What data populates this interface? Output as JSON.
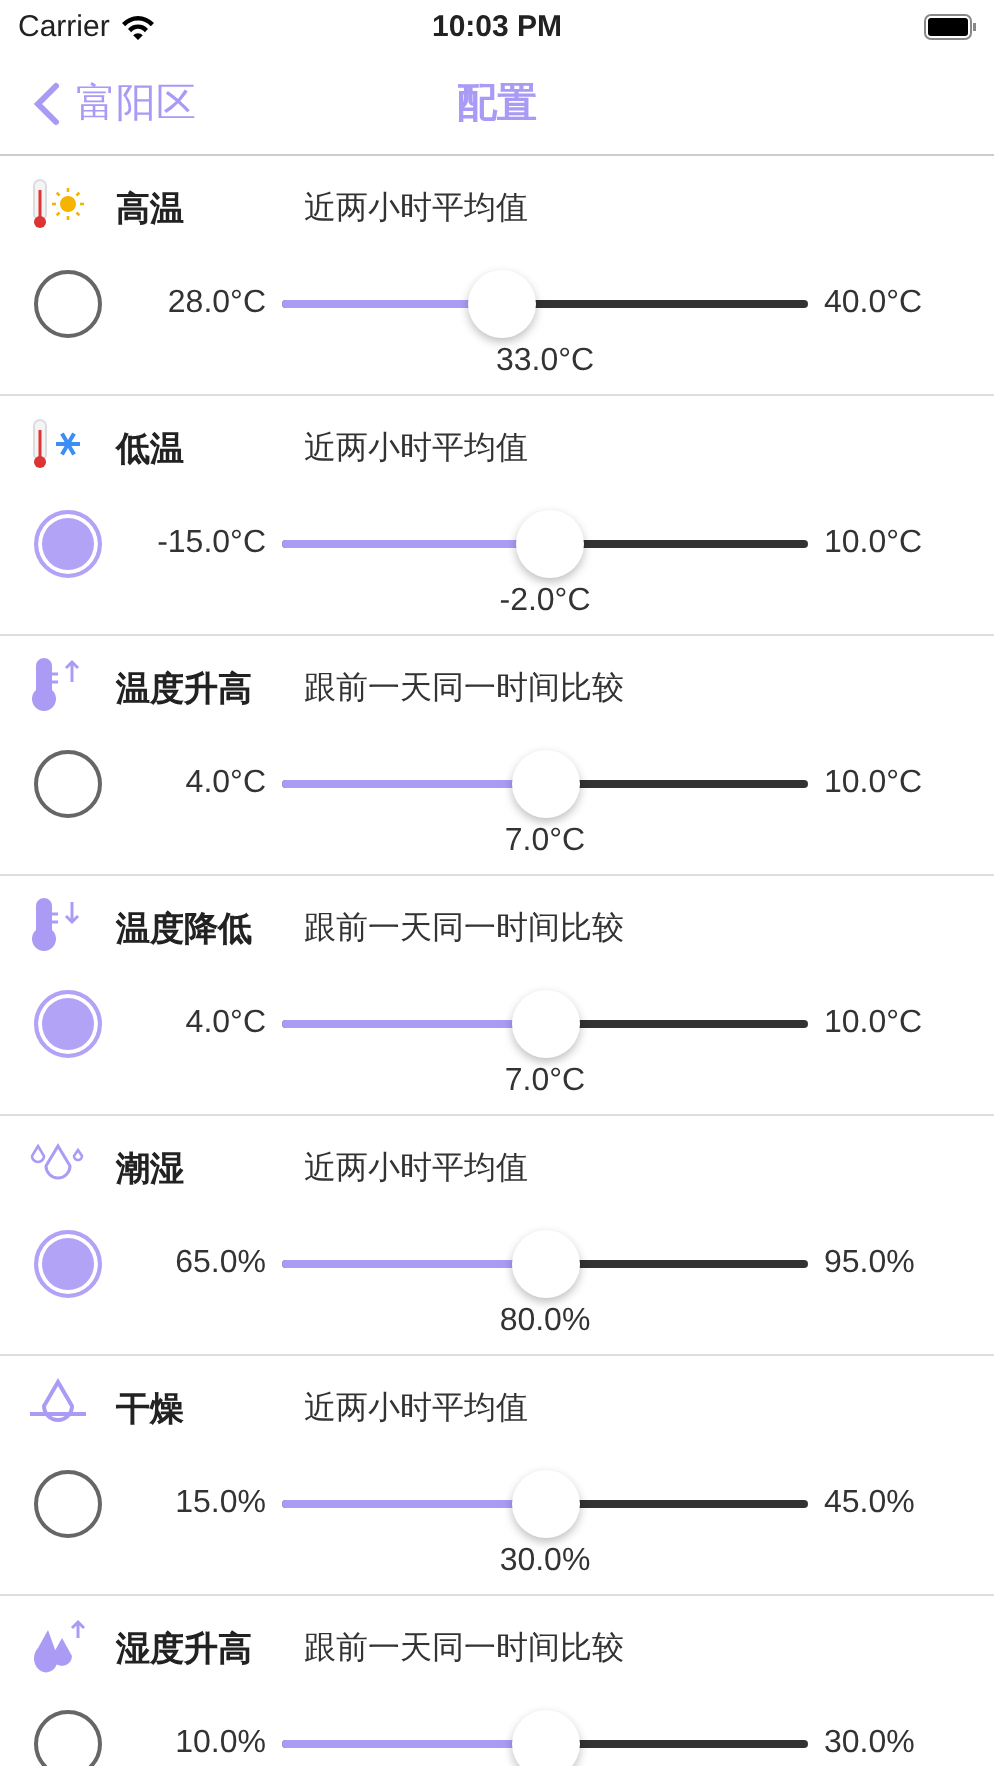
{
  "status_bar": {
    "carrier": "Carrier",
    "time": "10:03 PM"
  },
  "nav": {
    "back": "富阳区",
    "title": "配置"
  },
  "rules": [
    {
      "kind": "thermo-sun",
      "title": "高温",
      "note": "近两小时平均值",
      "checked": false,
      "min": "28.0°C",
      "max": "40.0°C",
      "level": 0.42,
      "value": "33.0°C"
    },
    {
      "kind": "thermo-snow",
      "title": "低温",
      "note": "近两小时平均值",
      "checked": true,
      "min": "-15.0°C",
      "max": "10.0°C",
      "level": 0.51,
      "value": "-2.0°C"
    },
    {
      "kind": "thermo-up",
      "title": "温度升高",
      "note": "跟前一天同一时间比较",
      "checked": false,
      "min": "4.0°C",
      "max": "10.0°C",
      "level": 0.5,
      "value": "7.0°C"
    },
    {
      "kind": "thermo-down",
      "title": "温度降低",
      "note": "跟前一天同一时间比较",
      "checked": true,
      "min": "4.0°C",
      "max": "10.0°C",
      "level": 0.5,
      "value": "7.0°C"
    },
    {
      "kind": "drops",
      "title": "潮湿",
      "note": "近两小时平均值",
      "checked": true,
      "min": "65.0%",
      "max": "95.0%",
      "level": 0.5,
      "value": "80.0%"
    },
    {
      "kind": "drop-line",
      "title": "干燥",
      "note": "近两小时平均值",
      "checked": false,
      "min": "15.0%",
      "max": "45.0%",
      "level": 0.5,
      "value": "30.0%"
    },
    {
      "kind": "drops-up",
      "title": "湿度升高",
      "note": "跟前一天同一时间比较",
      "checked": false,
      "min": "10.0%",
      "max": "30.0%",
      "level": 0.5
    }
  ]
}
